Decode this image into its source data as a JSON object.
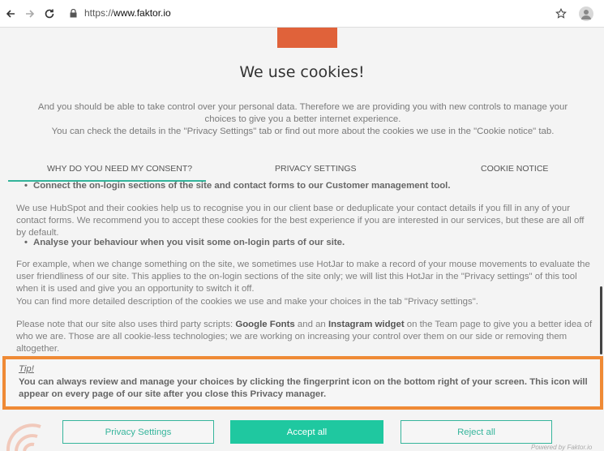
{
  "browser": {
    "url_protocol": "https://",
    "url_host": "www.faktor.io"
  },
  "modal": {
    "title": "We use cookies!",
    "intro_line1": "And you should be able to take control over your personal data. Therefore we are providing you with new controls to manage your choices to give you a better internet experience.",
    "intro_line2": "You can check the details in the \"Privacy Settings\" tab or find out more about the cookies we use in the \"Cookie notice\" tab.",
    "tabs": [
      {
        "label": "WHY DO YOU NEED MY CONSENT?"
      },
      {
        "label": "PRIVACY SETTINGS"
      },
      {
        "label": "COOKIE NOTICE"
      }
    ],
    "content": {
      "bullet1": "Connect the on-login sections of the site and contact forms to our Customer management tool.",
      "para1": "We use HubSpot and their cookies help us to recognise you in our client base or deduplicate your contact details if you fill in any of your contact forms. We recommend you to accept these cookies for the best experience if you are interested in our services, but these are all off by default.",
      "bullet2": "Analyse your behaviour when you visit some on-login parts of our site.",
      "para2": "For example, when we change something on the site, we sometimes use HotJar to make a record of your mouse movements to evaluate the user friendliness of our site. This applies to the on-login sections of the site only; we will list this HotJar in the \"Privacy settings\" of this tool when it is used and give you an opportunity to switch it off.",
      "para3": "You can find more detailed description of the cookies we use and make your choices in the tab \"Privacy settings\".",
      "para4_a": "Please note that our site also uses third party scripts: ",
      "para4_b": "Google Fonts",
      "para4_c": " and an ",
      "para4_d": "Instagram widget",
      "para4_e": " on the Team page to give you a better idea of who we are. Those are all cookie-less technologies; we are working on increasing your control over them on our side or removing them altogether."
    },
    "tip": {
      "title": "Tip!",
      "text": "You can always review and manage your choices by clicking the fingerprint icon on the bottom right of your screen. This icon will appear on every page of our site after you close this Privacy manager."
    },
    "buttons": {
      "privacy_settings": "Privacy Settings",
      "accept_all": "Accept all",
      "reject_all": "Reject all"
    },
    "powered_by": "Powered by Faktor.io"
  },
  "colors": {
    "accent": "#1fc8a0",
    "highlight_border": "#ef8a35",
    "logo": "#e0623a"
  }
}
